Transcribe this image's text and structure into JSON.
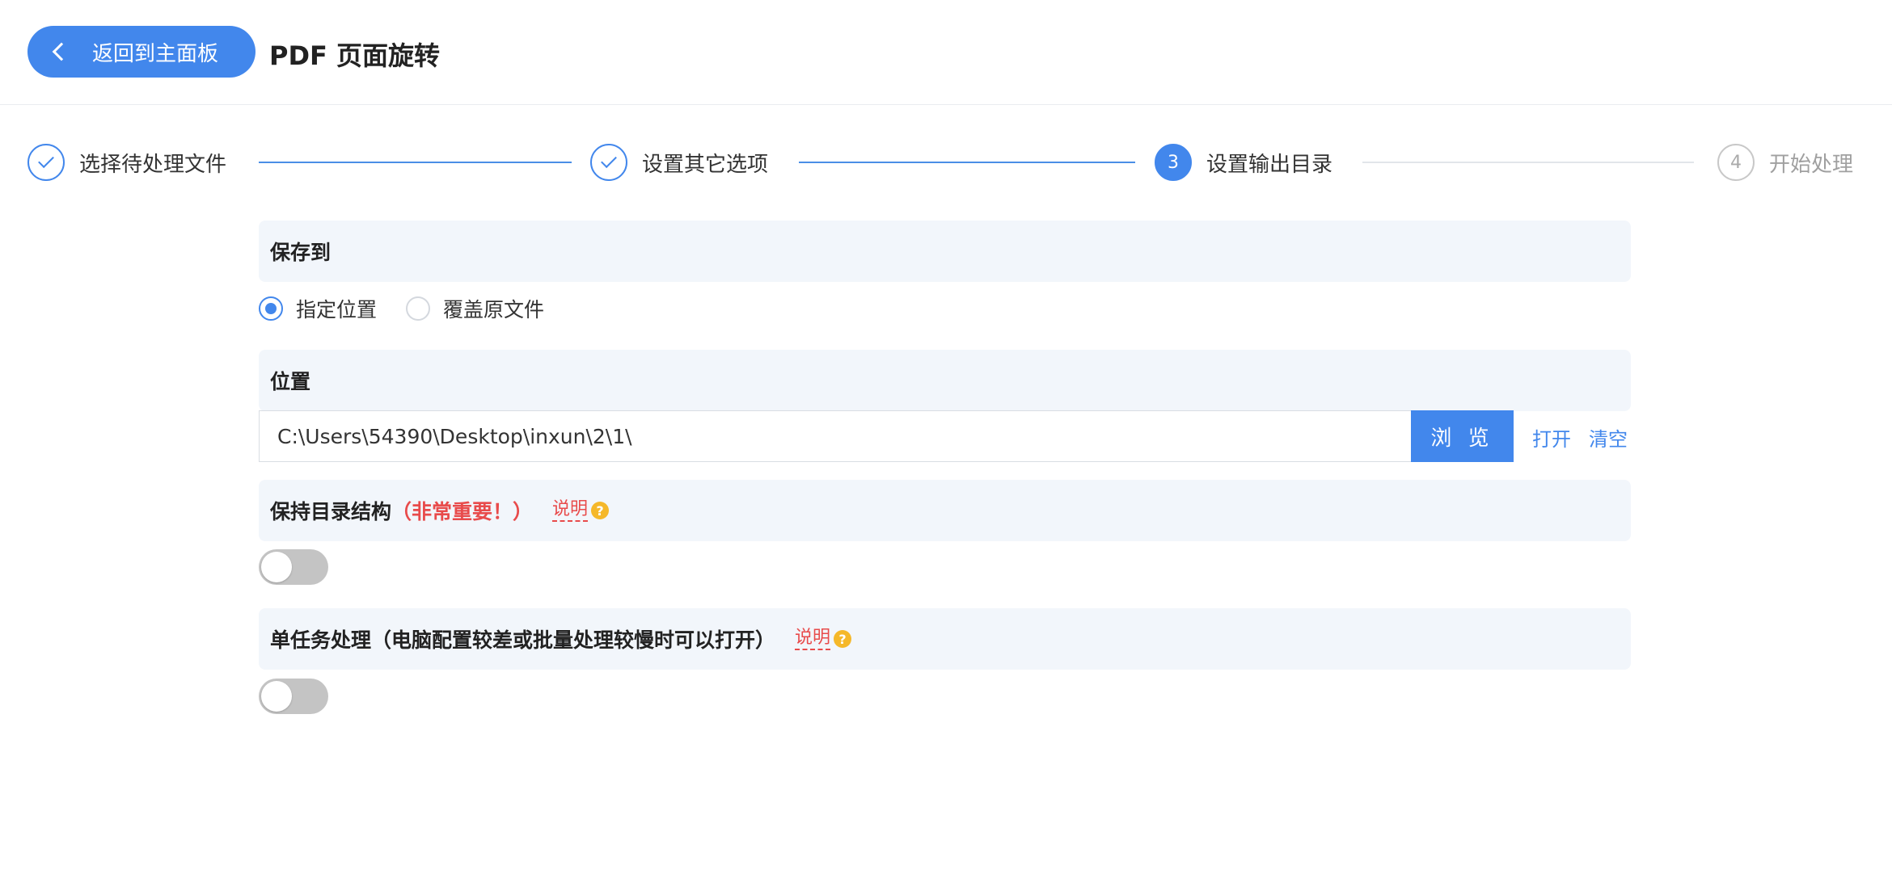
{
  "header": {
    "back_label": "返回到主面板",
    "title": "PDF 页面旋转"
  },
  "steps": [
    {
      "label": "选择待处理文件",
      "status": "done"
    },
    {
      "label": "设置其它选项",
      "status": "done"
    },
    {
      "label": "设置输出目录",
      "status": "active",
      "number": "3"
    },
    {
      "label": "开始处理",
      "status": "pending",
      "number": "4"
    }
  ],
  "save_to": {
    "title": "保存到",
    "options": [
      {
        "label": "指定位置",
        "checked": true
      },
      {
        "label": "覆盖原文件",
        "checked": false
      }
    ]
  },
  "location": {
    "title": "位置",
    "value": "C:\\Users\\54390\\Desktop\\inxun\\2\\1\\",
    "browse_label": "浏 览",
    "open_label": "打开",
    "clear_label": "清空"
  },
  "keep_structure": {
    "title": "保持目录结构",
    "warning": "（非常重要！）",
    "help_label": "说明",
    "enabled": false
  },
  "single_task": {
    "title": "单任务处理（电脑配置较差或批量处理较慢时可以打开）",
    "help_label": "说明",
    "enabled": false
  },
  "colors": {
    "accent": "#4287ec",
    "warning": "#e84b4b",
    "section_bg": "#f2f6fb"
  }
}
